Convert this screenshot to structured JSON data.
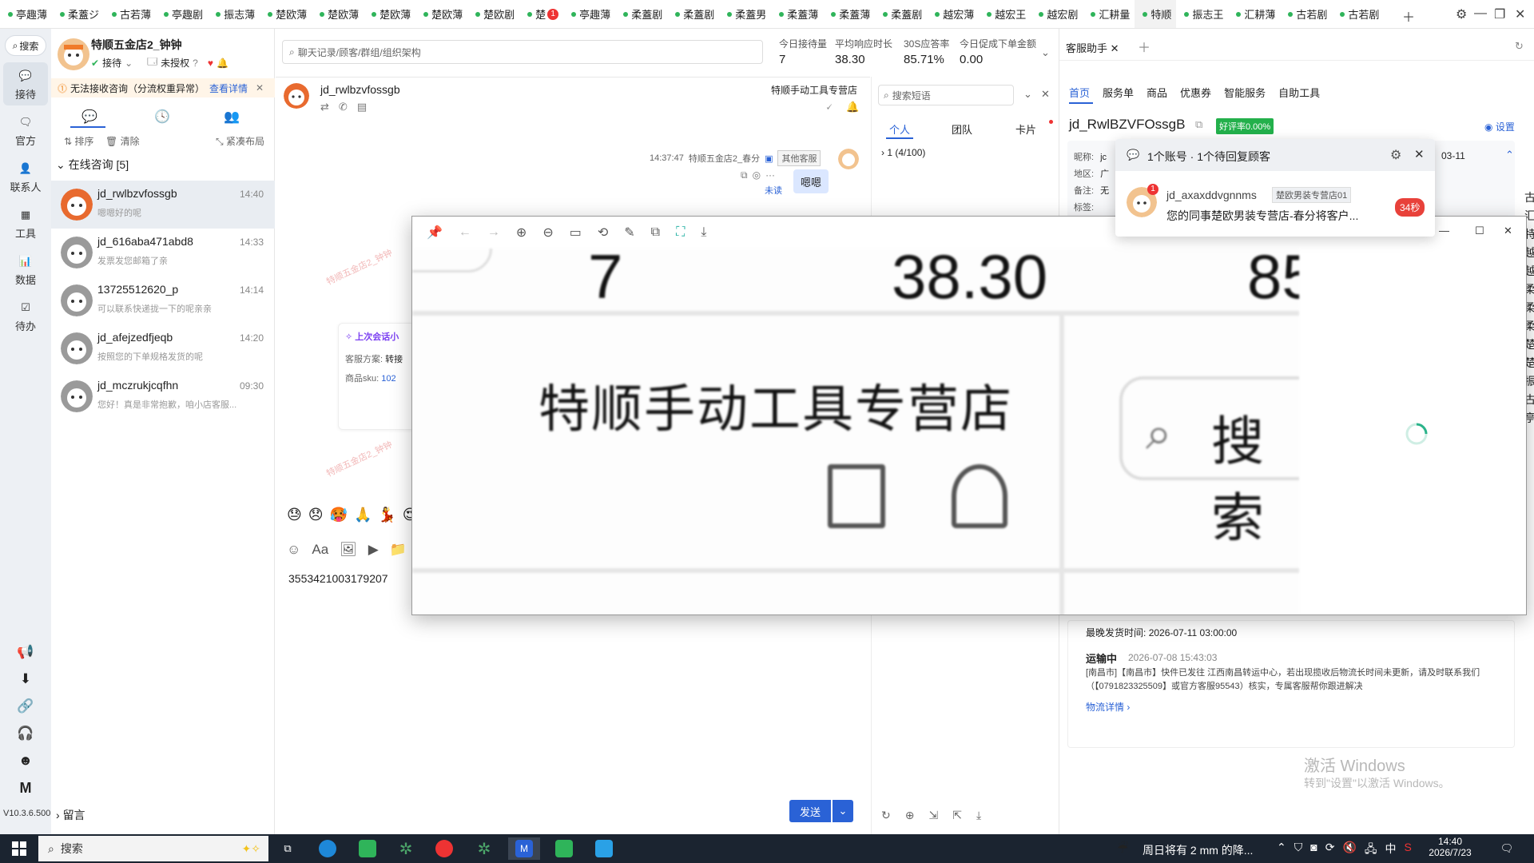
{
  "tabs": [
    {
      "label": "亭趣薄"
    },
    {
      "label": "柔蓋ジ"
    },
    {
      "label": "古若薄"
    },
    {
      "label": "亭趣剧"
    },
    {
      "label": "振志薄"
    },
    {
      "label": "楚欧薄"
    },
    {
      "label": "楚欧薄"
    },
    {
      "label": "楚欧薄"
    },
    {
      "label": "楚欧薄"
    },
    {
      "label": "楚欧剧"
    },
    {
      "label": "楚",
      "badge": "1"
    },
    {
      "label": "亭趣薄"
    },
    {
      "label": "柔蓋剧"
    },
    {
      "label": "柔蓋剧"
    },
    {
      "label": "柔蓋男"
    },
    {
      "label": "柔蓋薄"
    },
    {
      "label": "柔蓋薄"
    },
    {
      "label": "柔蓋剧"
    },
    {
      "label": "越宏薄"
    },
    {
      "label": "越宏王"
    },
    {
      "label": "越宏剧"
    },
    {
      "label": "汇耕量"
    },
    {
      "label": "特顺",
      "active": true
    },
    {
      "label": "振志王"
    },
    {
      "label": "汇耕薄"
    },
    {
      "label": "古若剧"
    },
    {
      "label": "古若剧"
    }
  ],
  "nav": {
    "search": "搜索",
    "items": [
      {
        "label": "接待",
        "icon": "chat-icon"
      },
      {
        "label": "官方",
        "icon": "message-icon"
      },
      {
        "label": "联系人",
        "icon": "person-icon"
      },
      {
        "label": "工具",
        "icon": "grid-icon"
      },
      {
        "label": "数据",
        "icon": "chart-icon"
      },
      {
        "label": "待办",
        "icon": "todo-icon"
      }
    ],
    "version": "V10.3.6.500"
  },
  "account": {
    "name": "特顺五金店2_钟钟",
    "status": "接待",
    "auth": "未授权"
  },
  "warning": {
    "text": "无法接收咨询（分流权重异常）",
    "link": "查看详情"
  },
  "list_tools": {
    "sort": "排序",
    "clear": "清除",
    "layout": "紧凑布局"
  },
  "online_group": "在线咨询 [5]",
  "contacts": [
    {
      "name": "jd_rwlbzvfossgb",
      "time": "14:40",
      "preview": "嗯嗯好的呢"
    },
    {
      "name": "jd_616aba471abd8",
      "time": "14:33",
      "preview": "发票发您邮箱了亲"
    },
    {
      "name": "13725512620_p",
      "time": "14:14",
      "preview": "可以联系快递拢一下的呢亲亲"
    },
    {
      "name": "jd_afejzedfjeqb",
      "time": "14:20",
      "preview": "按照您的下单规格发货的呢"
    },
    {
      "name": "jd_mczrukjcqfhn",
      "time": "09:30",
      "preview": "您好！真是非常抱歉，咱小店客服..."
    }
  ],
  "leave_msg": "留言",
  "search_placeholder": "聊天记录/顾客/群组/组织架构",
  "stats": [
    {
      "label": "今日接待量",
      "value": "7"
    },
    {
      "label": "平均响应时长",
      "value": "38.30"
    },
    {
      "label": "30S应答率",
      "value": "85.71%"
    },
    {
      "label": "今日促成下单金额",
      "value": "0.00"
    }
  ],
  "chat": {
    "customer": "jd_rwlbzvfossgb",
    "shop": "特顺手动工具专营店",
    "msg_time": "14:37:47",
    "msg_sender": "特顺五金店2_春分",
    "msg_tag": "其他客服",
    "msg_text": "嗯嗯",
    "msg_status": "未读",
    "watermark": "特顺五金店2_钟钟",
    "last_session_title": "上次会话小",
    "last_session_plan_label": "客服方案:",
    "last_session_plan": "转接",
    "last_session_sku_label": "商品sku:",
    "last_session_sku": "102",
    "input_text": "3553421003179207",
    "send": "发送",
    "emojis": [
      "😓",
      "😞",
      "🥵",
      "🙏",
      "💃",
      "😍"
    ]
  },
  "quick": {
    "search_placeholder": "搜索短语",
    "tabs": [
      "个人",
      "团队",
      "卡片"
    ],
    "group": "1 (4/100)"
  },
  "assistant": {
    "tab": "客服助手",
    "nav": [
      "首页",
      "服务单",
      "商品",
      "优惠券",
      "智能服务",
      "自助工具"
    ],
    "customer_id": "jd_RwlBZVFOssgB",
    "rating": "好评率0.00%",
    "settings": "设置",
    "fields": [
      "昵称:",
      "地区:",
      "备注:",
      "标签:"
    ],
    "field_values": [
      "jc",
      "广",
      "无"
    ],
    "date_snip": "03-11",
    "latest_ship_label": "最晚发货时间:",
    "latest_ship": "2026-07-11 03:00:00",
    "logistics_status": "运输中",
    "logistics_time": "2026-07-08 15:43:03",
    "logistics_text": "[南昌市]【南昌市】快件已发往 江西南昌转运中心，若出现揽收后物流长时间未更新，请及时联系我们（【0791823325509】或官方客服95543）核实，专属客服帮你跟进解决",
    "logistics_link": "物流详情",
    "activate_title": "激活 Windows",
    "activate_sub": "转到\"设置\"以激活 Windows。"
  },
  "popup": {
    "title": "1个账号 · 1个待回复顾客",
    "name": "jd_axaxddvgnnms",
    "shop": "楚欧男装专营店01",
    "msg": "您的同事楚欧男装专营店-春分将客户...",
    "timer": "34秒",
    "badge": "1"
  },
  "viewer": {
    "big_nums": [
      "7",
      "38.30",
      "85"
    ],
    "shop_big": "特顺手动工具专营店",
    "search_big": "搜索"
  },
  "right_edge_chars": [
    "古",
    "汇",
    "特",
    "越",
    "越",
    "柔",
    "柔",
    "柔",
    "楚",
    "楚",
    "振",
    "古",
    "亭"
  ],
  "taskbar": {
    "search": "搜索",
    "weather": "周日将有 2 mm 的降...",
    "ime": "中",
    "time": "14:40",
    "date": "2026/7/23"
  }
}
